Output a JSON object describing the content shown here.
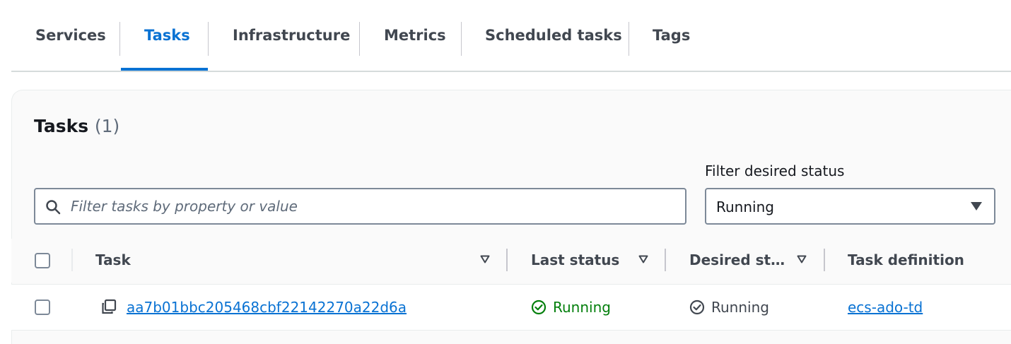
{
  "tabs": [
    {
      "label": "Services",
      "active": false
    },
    {
      "label": "Tasks",
      "active": true
    },
    {
      "label": "Infrastructure",
      "active": false
    },
    {
      "label": "Metrics",
      "active": false
    },
    {
      "label": "Scheduled tasks",
      "active": false
    },
    {
      "label": "Tags",
      "active": false
    }
  ],
  "panel": {
    "title": "Tasks",
    "count": "(1)"
  },
  "search": {
    "placeholder": "Filter tasks by property or value",
    "value": ""
  },
  "status_filter": {
    "label": "Filter desired status",
    "value": "Running"
  },
  "table": {
    "columns": [
      {
        "label": "Task",
        "sortable": true
      },
      {
        "label": "Last status",
        "sortable": true
      },
      {
        "label": "Desired st…",
        "sortable": true
      },
      {
        "label": "Task definition",
        "sortable": false
      }
    ],
    "rows": [
      {
        "task": "aa7b01bbc205468cbf22142270a22d6a",
        "last_status": "Running",
        "desired_status": "Running",
        "task_definition": "ecs-ado-td"
      }
    ]
  },
  "colors": {
    "accent": "#0972d3",
    "success": "#037f0c",
    "neutral": "#414750"
  },
  "icons": {
    "search": "search-icon",
    "dropdown": "caret-down-icon",
    "sort": "sort-caret-icon",
    "copy": "copy-icon",
    "last_status": "check-circle-icon",
    "desired_status": "check-circle-outline-icon"
  }
}
